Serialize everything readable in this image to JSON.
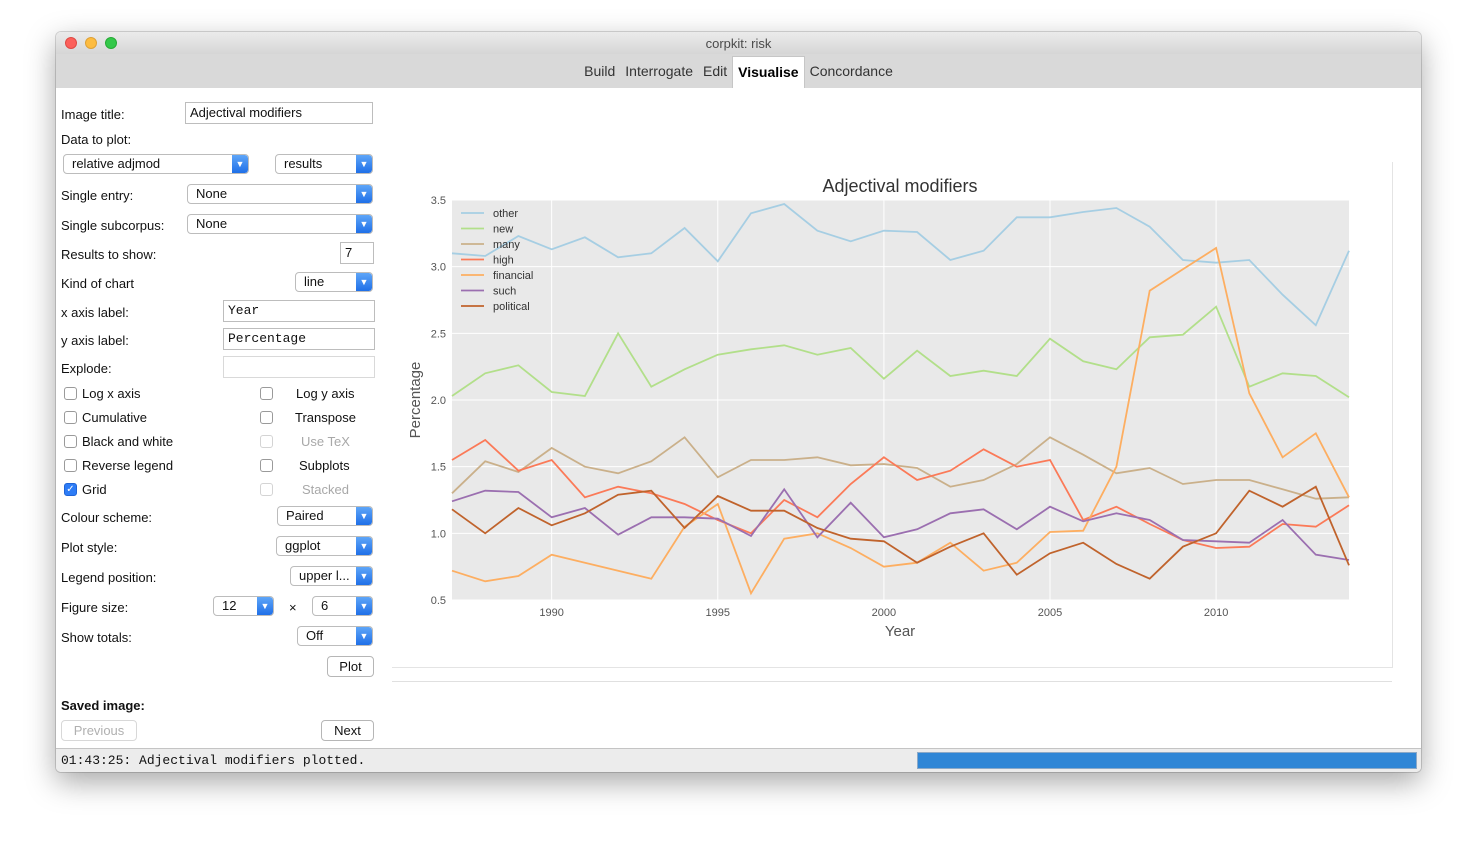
{
  "window": {
    "title": "corpkit: risk"
  },
  "tabs": [
    {
      "label": "Build"
    },
    {
      "label": "Interrogate"
    },
    {
      "label": "Edit"
    },
    {
      "label": "Visualise",
      "active": true
    },
    {
      "label": "Concordance"
    }
  ],
  "panel": {
    "image_title_label": "Image title:",
    "image_title_value": "Adjectival modifiers",
    "data_to_plot_label": "Data to plot:",
    "data_to_plot_value": "relative adjmod",
    "data_kind_value": "results",
    "single_entry_label": "Single entry:",
    "single_entry_value": "None",
    "single_subcorpus_label": "Single subcorpus:",
    "single_subcorpus_value": "None",
    "results_to_show_label": "Results to show:",
    "results_to_show_value": "7",
    "kind_of_chart_label": "Kind of chart",
    "kind_of_chart_value": "line",
    "x_axis_label_label": "x axis label:",
    "x_axis_label_value": "Year",
    "y_axis_label_label": "y axis label:",
    "y_axis_label_value": "Percentage",
    "explode_label": "Explode:",
    "explode_value": "",
    "checkboxes": {
      "log_x": {
        "label": "Log x axis",
        "checked": false
      },
      "log_y": {
        "label": "Log y axis",
        "checked": false
      },
      "cumulative": {
        "label": "Cumulative",
        "checked": false
      },
      "transpose": {
        "label": "Transpose",
        "checked": false
      },
      "bw": {
        "label": "Black and white",
        "checked": false
      },
      "use_tex": {
        "label": "Use TeX",
        "checked": false,
        "disabled": true
      },
      "reverse_legend": {
        "label": "Reverse legend",
        "checked": false
      },
      "subplots": {
        "label": "Subplots",
        "checked": false
      },
      "grid": {
        "label": "Grid",
        "checked": true
      },
      "stacked": {
        "label": "Stacked",
        "checked": false,
        "disabled": true
      }
    },
    "colour_scheme_label": "Colour scheme:",
    "colour_scheme_value": "Paired",
    "plot_style_label": "Plot style:",
    "plot_style_value": "ggplot",
    "legend_position_label": "Legend position:",
    "legend_position_value": "upper l...",
    "figure_size_label": "Figure size:",
    "figure_width": "12",
    "figure_times": "×",
    "figure_height": "6",
    "show_totals_label": "Show totals:",
    "show_totals_value": "Off",
    "plot_button": "Plot",
    "saved_image_label": "Saved image:",
    "previous_button": "Previous",
    "next_button": "Next"
  },
  "toolbar": [
    "home-icon",
    "back-arrow-icon",
    "forward-arrow-icon",
    "pan-icon",
    "configure-subplots-icon",
    "zoom-rect-icon",
    "save-icon"
  ],
  "status": {
    "message": "01:43:25: Adjectival modifiers plotted.",
    "progress": 1.0
  },
  "colors": {
    "accent": "#2d7cf6",
    "plot_bg": "#e9e9e9",
    "progress": "#2f86d6"
  },
  "chart_data": {
    "type": "line",
    "title": "Adjectival modifiers",
    "xlabel": "Year",
    "ylabel": "Percentage",
    "xlim": [
      1987,
      2014
    ],
    "ylim": [
      0.5,
      3.5
    ],
    "xticks": [
      1990,
      1995,
      2000,
      2005,
      2010
    ],
    "yticks": [
      "0.5",
      "1.0",
      "1.5",
      "2.0",
      "2.5",
      "3.0",
      "3.5"
    ],
    "grid": true,
    "legend_position": "upper-left",
    "x": [
      1987,
      1988,
      1989,
      1990,
      1991,
      1992,
      1993,
      1994,
      1995,
      1996,
      1997,
      1998,
      1999,
      2000,
      2001,
      2002,
      2003,
      2004,
      2005,
      2006,
      2007,
      2008,
      2009,
      2010,
      2011,
      2012,
      2013,
      2014
    ],
    "series": [
      {
        "name": "other",
        "color": "#a6cee3",
        "values": [
          3.1,
          3.08,
          3.23,
          3.13,
          3.22,
          3.07,
          3.1,
          3.29,
          3.04,
          3.4,
          3.47,
          3.27,
          3.19,
          3.27,
          3.26,
          3.05,
          3.12,
          3.37,
          3.37,
          3.41,
          3.44,
          3.3,
          3.05,
          3.03,
          3.05,
          2.79,
          2.56,
          3.12
        ]
      },
      {
        "name": "new",
        "color": "#b2df8a",
        "values": [
          2.03,
          2.2,
          2.26,
          2.06,
          2.03,
          2.5,
          2.1,
          2.23,
          2.34,
          2.38,
          2.41,
          2.34,
          2.39,
          2.16,
          2.37,
          2.18,
          2.22,
          2.18,
          2.46,
          2.29,
          2.23,
          2.47,
          2.49,
          2.7,
          2.1,
          2.2,
          2.18,
          2.02
        ]
      },
      {
        "name": "many",
        "color": "#cab08a",
        "values": [
          1.3,
          1.54,
          1.46,
          1.64,
          1.5,
          1.45,
          1.54,
          1.72,
          1.42,
          1.55,
          1.55,
          1.57,
          1.51,
          1.52,
          1.49,
          1.35,
          1.4,
          1.52,
          1.72,
          1.59,
          1.45,
          1.49,
          1.37,
          1.4,
          1.4,
          1.33,
          1.26,
          1.27
        ]
      },
      {
        "name": "high",
        "color": "#fb7a58",
        "values": [
          1.55,
          1.7,
          1.47,
          1.55,
          1.27,
          1.35,
          1.3,
          1.22,
          1.1,
          1.0,
          1.25,
          1.12,
          1.37,
          1.57,
          1.4,
          1.47,
          1.63,
          1.5,
          1.55,
          1.1,
          1.2,
          1.07,
          0.95,
          0.89,
          0.9,
          1.07,
          1.05,
          1.21
        ]
      },
      {
        "name": "financial",
        "color": "#fdae61",
        "values": [
          0.72,
          0.64,
          0.68,
          0.84,
          0.78,
          0.72,
          0.66,
          1.05,
          1.22,
          0.55,
          0.96,
          1.0,
          0.89,
          0.75,
          0.78,
          0.93,
          0.72,
          0.78,
          1.01,
          1.02,
          1.5,
          2.82,
          2.98,
          3.14,
          2.05,
          1.57,
          1.75,
          1.27
        ]
      },
      {
        "name": "such",
        "color": "#9b6fb0",
        "values": [
          1.24,
          1.32,
          1.31,
          1.12,
          1.19,
          0.99,
          1.12,
          1.12,
          1.11,
          0.98,
          1.33,
          0.97,
          1.23,
          0.97,
          1.03,
          1.15,
          1.18,
          1.03,
          1.2,
          1.09,
          1.15,
          1.1,
          0.95,
          0.94,
          0.93,
          1.1,
          0.84,
          0.8
        ]
      },
      {
        "name": "political",
        "color": "#c0632c",
        "values": [
          1.18,
          1.0,
          1.19,
          1.06,
          1.15,
          1.29,
          1.32,
          1.04,
          1.28,
          1.17,
          1.17,
          1.04,
          0.96,
          0.94,
          0.78,
          0.9,
          1.0,
          0.69,
          0.85,
          0.93,
          0.77,
          0.66,
          0.9,
          1.0,
          1.32,
          1.2,
          1.35,
          0.76
        ]
      }
    ]
  }
}
